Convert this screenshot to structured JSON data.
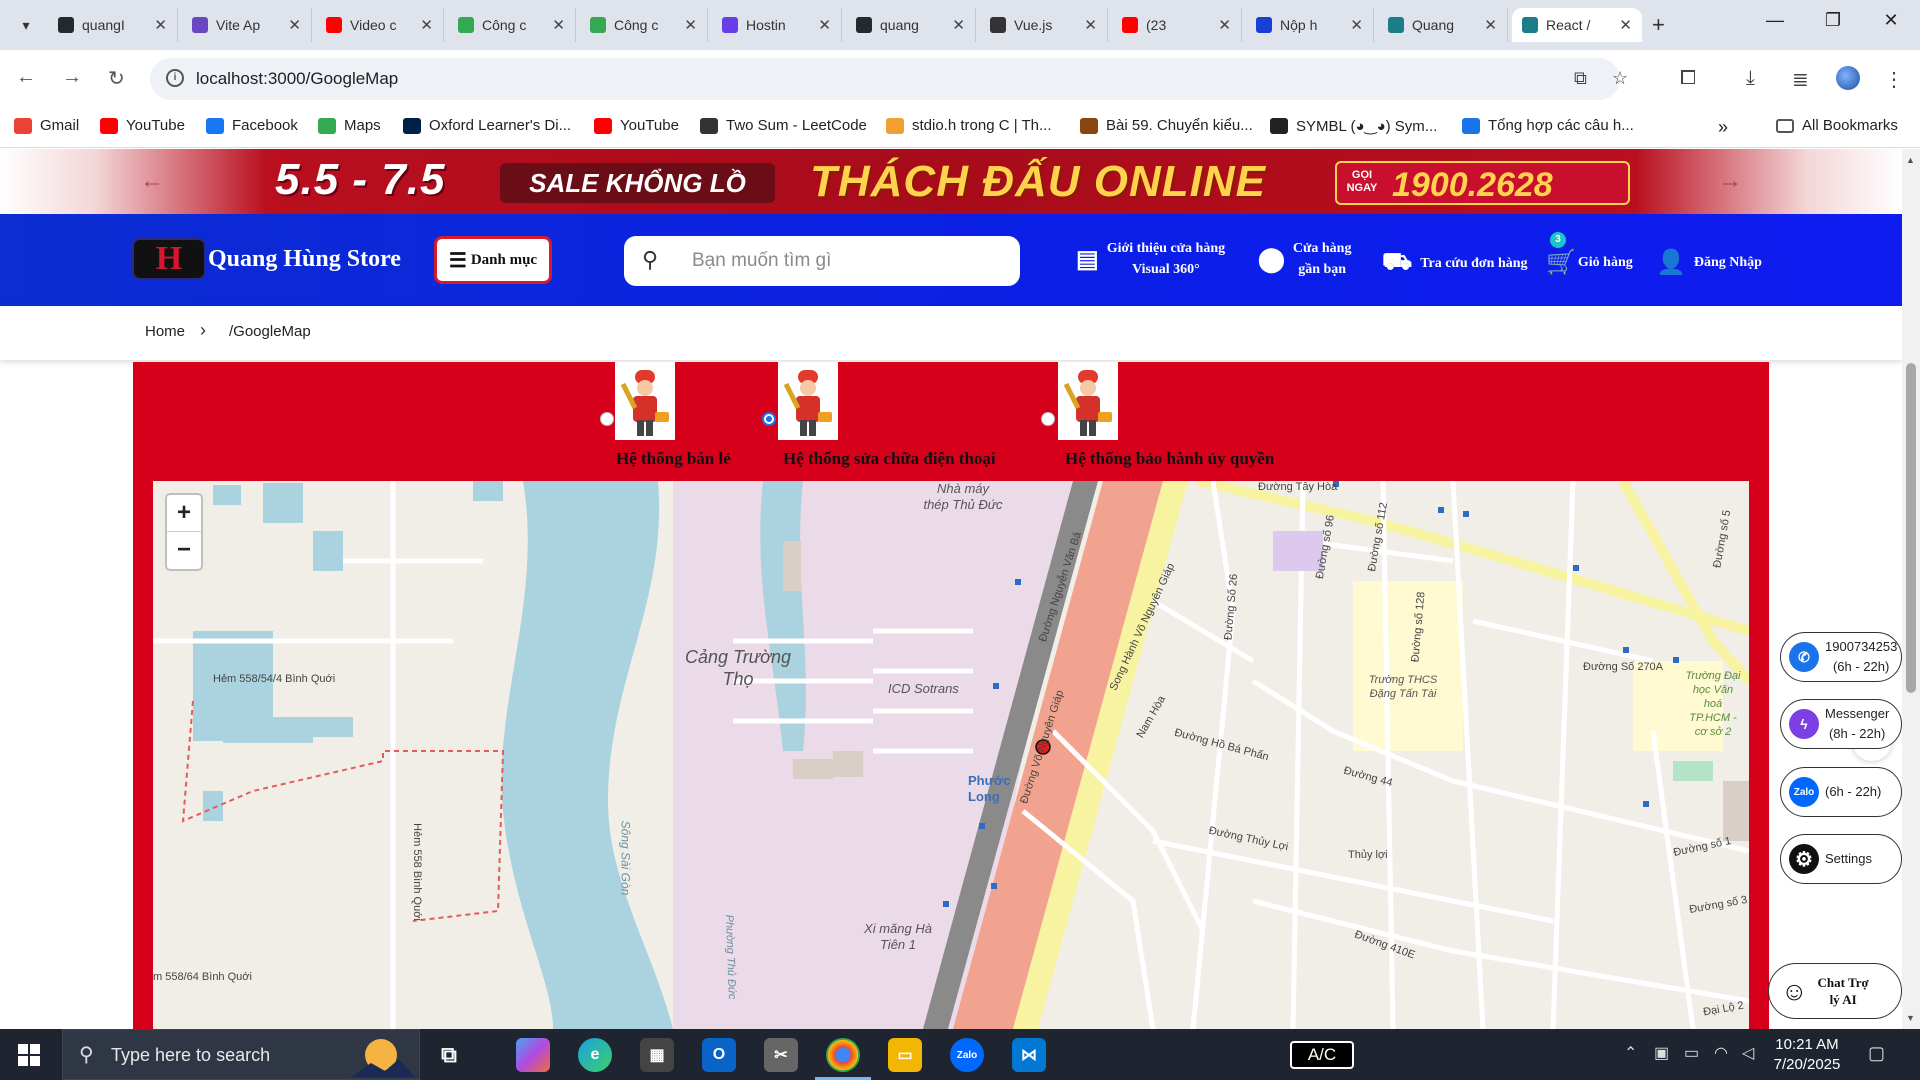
{
  "browser": {
    "tabs": [
      {
        "label": "quangI",
        "icon": "github-icon",
        "color": "#24292f"
      },
      {
        "label": "Vite Ap",
        "icon": "vite-icon",
        "color": "#6b46c1"
      },
      {
        "label": "Video c",
        "icon": "youtube-icon",
        "color": "#ff0000"
      },
      {
        "label": "Công c",
        "icon": "sheets-icon",
        "color": "#34a853"
      },
      {
        "label": "Công c",
        "icon": "sheets-icon",
        "color": "#34a853"
      },
      {
        "label": "Hostin",
        "icon": "hosting-icon",
        "color": "#673de6"
      },
      {
        "label": "quang",
        "icon": "github-icon",
        "color": "#24292f"
      },
      {
        "label": "Vue.js",
        "icon": "vue-icon",
        "color": "#333333"
      },
      {
        "label": "(23",
        "icon": "youtube-icon",
        "color": "#ff0000"
      },
      {
        "label": "Nộp h",
        "icon": "coccoc-icon",
        "color": "#1a3fd6"
      },
      {
        "label": "Quang",
        "icon": "react-icon",
        "color": "#1b7d87"
      },
      {
        "label": "React /",
        "icon": "react-icon",
        "color": "#1b7d87",
        "active": true
      }
    ],
    "url": "localhost:3000/GoogleMap",
    "bookmarks": [
      {
        "label": "Gmail",
        "color": "#ea4335"
      },
      {
        "label": "YouTube",
        "color": "#ff0000"
      },
      {
        "label": "Facebook",
        "color": "#1877f2"
      },
      {
        "label": "Maps",
        "color": "#34a853"
      },
      {
        "label": "Oxford Learner's Di...",
        "color": "#002147"
      },
      {
        "label": "YouTube",
        "color": "#ff0000"
      },
      {
        "label": "Two Sum - LeetCode",
        "color": "#333333"
      },
      {
        "label": "stdio.h trong C | Th...",
        "color": "#f0a030"
      },
      {
        "label": "Bài 59. Chuyển kiểu...",
        "color": "#8b4513"
      },
      {
        "label": "SYMBL (◕‿◕) Sym...",
        "color": "#222222"
      },
      {
        "label": "Tổng hợp các câu h...",
        "color": "#1a73e8"
      }
    ],
    "all_bookmarks": "All Bookmarks"
  },
  "promo": {
    "dates": "5.5 - 7.5",
    "sale": "SALE KHỔNG LỒ",
    "headline": "THÁCH ĐẤU ONLINE",
    "call_label": "GỌI NGAY",
    "phone": "1900.2628"
  },
  "header": {
    "logo_letter": "H",
    "store_name": "Quang Hùng Store",
    "menu_label": "Danh mục",
    "search_placeholder": "Bạn muốn tìm gì",
    "nav": {
      "intro_line1": "Giới thiệu cửa hàng",
      "intro_line2": "Visual 360°",
      "near_line1": "Cửa hàng",
      "near_line2": "gần bạn",
      "track": "Tra cứu đơn hàng",
      "cart": "Giỏ hàng",
      "cart_count": "3",
      "login": "Đăng Nhập"
    }
  },
  "breadcrumb": {
    "home": "Home",
    "current": "/GoogleMap"
  },
  "systems": [
    {
      "label": "Hệ thống bán lẻ",
      "selected": false
    },
    {
      "label": "Hệ thống sửa chữa điện thoại",
      "selected": true
    },
    {
      "label": "Hệ thống bảo hành ủy quyền",
      "selected": false
    }
  ],
  "map": {
    "zoom_in": "+",
    "zoom_out": "−",
    "labels": {
      "port": "Cảng Trường Thọ",
      "factory": "Nhà máy thép Thủ Đức",
      "icd": "ICD Sotrans",
      "cement": "Xi măng Hà Tiên 1",
      "ward": "Phước Long",
      "river": "Sông Sài Gòn",
      "hem1": "Hẻm 558/54/4 Bình Quới",
      "hem2": "Hẻm 558 Bình Quới",
      "hem3": "m 558/64 Bình Quới",
      "road_tay_hoa": "Đường Tây Hòa",
      "road_vo_nguyen_giap": "Đường Võ Nguyên Giáp",
      "road_nguyen_van_ba": "Đường Nguyễn Văn Bá",
      "road_ho_ba_phan": "Đường Hồ Bá Phấn",
      "road_44": "Đường 44",
      "road_thuy_loi": "Đường Thủy Lợi",
      "school": "Trường THCS Đặng Tấn Tài",
      "road_270a": "Đường Số 270A",
      "university": "Trường Đại học Văn hoá TP.HCM - cơ sở 2",
      "nam_hoa": "Nam Hòa",
      "song_hanh": "Song Hành Võ Nguyên Giáp",
      "road_26": "Đường Số 26",
      "road_96": "Đường số 96",
      "road_112": "Đường số 112",
      "road_128": "Đường số 128",
      "road_410e": "Đường 410E",
      "thuy_loi2": "Thủy lợi",
      "phuong_thu_duc": "Phường Thủ Đức",
      "road_so1": "Đường số 1",
      "road_so5": "Đường số 5",
      "road_so3": "Đường số 3",
      "dai_lo2": "Đại Lộ 2"
    }
  },
  "contacts": [
    {
      "line1": "1900734253",
      "line2": "(6h - 22h)",
      "color": "#1a73e8"
    },
    {
      "line1": "Messenger",
      "line2": "(8h - 22h)",
      "color": "#7b3fe4"
    },
    {
      "line1": "(6h - 22h)",
      "badge": "Zalo",
      "color": "#0068ff"
    },
    {
      "line1": "Settings",
      "color": "#111111"
    }
  ],
  "chat_ai": {
    "line1": "Chat Trợ",
    "line2": "lý AI"
  },
  "taskbar": {
    "search_placeholder": "Type here to search",
    "ac_label": "A/C",
    "time": "10:21 AM",
    "date": "7/20/2025"
  }
}
